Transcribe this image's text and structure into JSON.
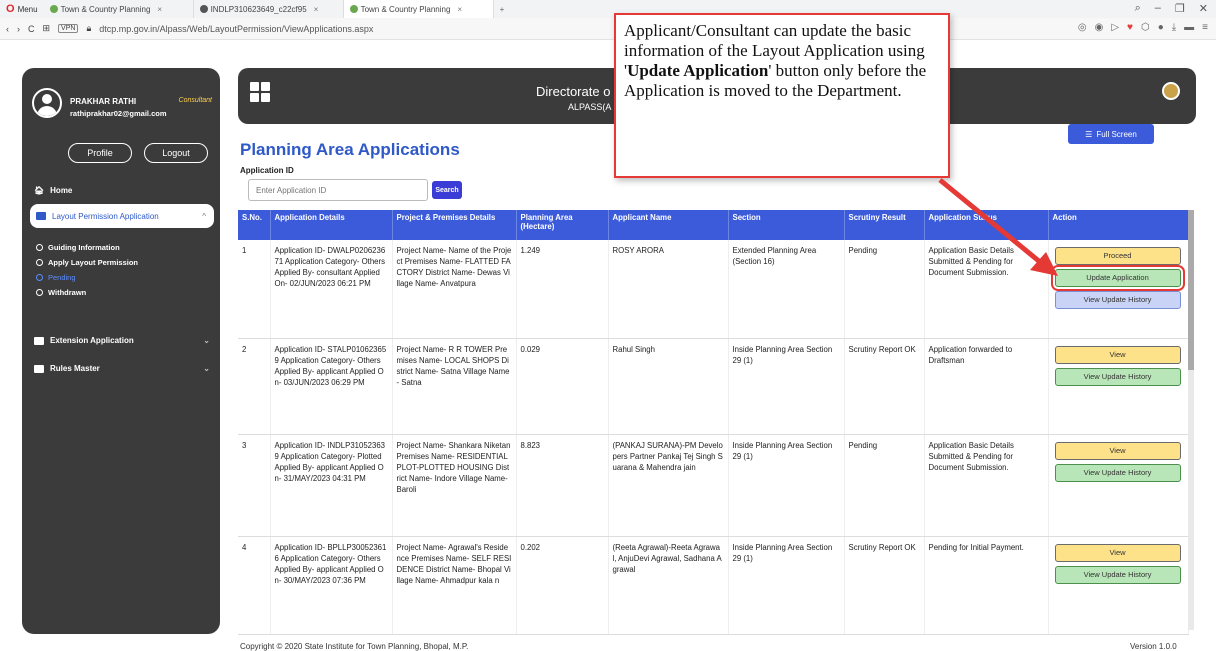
{
  "browser": {
    "menu_label": "Menu",
    "tabs": [
      {
        "title": "Town & Country Planning",
        "active": false
      },
      {
        "title": "INDLP310623649_c22cf95",
        "active": false
      },
      {
        "title": "Town & Country Planning",
        "active": true
      }
    ],
    "new_tab": "+",
    "vpn": "VPN",
    "url": "dtcp.mp.gov.in/Alpass/Web/LayoutPermission/ViewApplications.aspx"
  },
  "header": {
    "title": "Directorate o",
    "subtitle": "ALPASS(A"
  },
  "user": {
    "name": "PRAKHAR RATHI",
    "role": "Consultant",
    "email": "rathiprakhar02@gmail.com",
    "profile_label": "Profile",
    "logout_label": "Logout"
  },
  "sidebar": {
    "home": "Home",
    "active_item": "Layout Permission Application",
    "sub_items": [
      "Guiding Information",
      "Apply Layout Permission",
      "Pending",
      "Withdrawn"
    ],
    "extension": "Extension Application",
    "rules": "Rules Master"
  },
  "main": {
    "title": "Planning Area Applications",
    "fullscreen_label": "Full Screen",
    "appid_label": "Application ID",
    "appid_placeholder": "Enter Application ID",
    "search_label": "Search"
  },
  "table": {
    "headers": [
      "S.No.",
      "Application Details",
      "Project & Premises Details",
      "Planning Area (Hectare)",
      "Applicant Name",
      "Section",
      "Scrutiny Result",
      "Application Status",
      "Action"
    ],
    "rows": [
      {
        "sno": "1",
        "details": "Application ID- DWALP020623671 Application Category- Others Applied By- consultant Applied On- 02/JUN/2023 06:21 PM",
        "project": "Project Name- Name of the Project Premises Name- FLATTED FACTORY District Name- Dewas Village Name- Anvatpura",
        "area": "1.249",
        "applicant": "ROSY ARORA",
        "section": "Extended Planning Area (Section 16)",
        "scrutiny": "Pending",
        "status": "Application Basic Details Submitted & Pending for Document Submission.",
        "actions": [
          "Proceed",
          "Update Application",
          "View Update History"
        ]
      },
      {
        "sno": "2",
        "details": "Application ID- STALP010623659 Application Category- Others Applied By- applicant Applied On- 03/JUN/2023 06:29 PM",
        "project": "Project Name- R R TOWER Premises Name- LOCAL SHOPS District Name- Satna Village Name- Satna",
        "area": "0.029",
        "applicant": "Rahul Singh",
        "section": "Inside Planning Area Section 29 (1)",
        "scrutiny": "Scrutiny Report OK",
        "status": "Application forwarded to Draftsman",
        "actions": [
          "View",
          "View Update History"
        ]
      },
      {
        "sno": "3",
        "details": "Application ID- INDLP310523639 Application Category- Plotted Applied By- applicant Applied On- 31/MAY/2023 04:31 PM",
        "project": "Project Name- Shankara Niketan Premises Name- RESIDENTIAL PLOT-PLOTTED HOUSING District Name- Indore Village Name- Baroli",
        "area": "8.823",
        "applicant": "(PANKAJ SURANA)-PM Developers Partner Pankaj Tej Singh Suarana & Mahendra jain",
        "section": "Inside Planning Area Section 29 (1)",
        "scrutiny": "Pending",
        "status": "Application Basic Details Submitted & Pending for Document Submission.",
        "actions": [
          "View",
          "View Update History"
        ]
      },
      {
        "sno": "4",
        "details": "Application ID- BPLLP300523616 Application Category- Others Applied By- applicant Applied On- 30/MAY/2023 07:36 PM",
        "project": "Project Name- Agrawal's Residence Premises Name- SELF RESIDENCE District Name- Bhopal Village Name- Ahmadpur kala n",
        "area": "0.202",
        "applicant": "(Reeta Agrawal)-Reeta Agrawal, AnjuDevi Agrawal, Sadhana Agrawal",
        "section": "Inside Planning Area Section 29 (1)",
        "scrutiny": "Scrutiny Report OK",
        "status": "Pending for Initial Payment.",
        "actions": [
          "View",
          "View Update History"
        ]
      }
    ]
  },
  "footer": {
    "copyright": "Copyright © 2020 State Institute for Town Planning, Bhopal, M.P.",
    "version": "Version 1.0.0"
  },
  "callout": {
    "text_before": "Applicant/Consultant can update the basic information of the Layout Application using '",
    "text_bold": "Update Application",
    "text_after": "' button only before the Application is moved to the Department."
  },
  "colors": {
    "primary": "#3b5bdb",
    "sidebar": "#3b3b3b",
    "highlight": "#e53935",
    "proceed": "#fde28a",
    "update": "#b9e6b9"
  }
}
